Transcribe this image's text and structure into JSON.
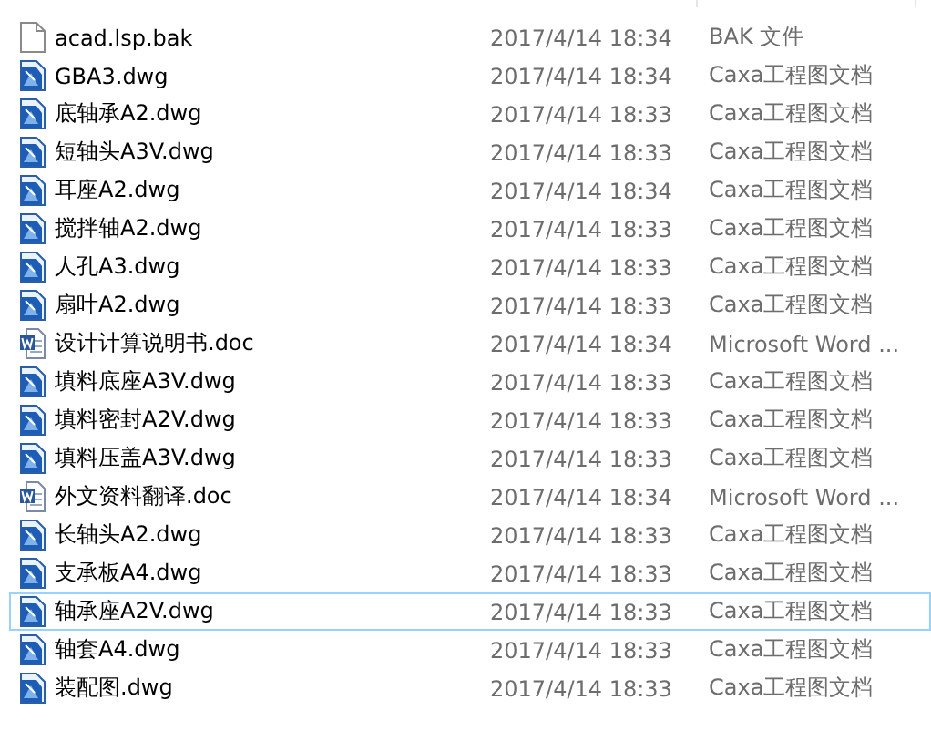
{
  "files": [
    {
      "kind": "bak",
      "name": "acad.lsp.bak",
      "modified": "2017/4/14 18:34",
      "type": "BAK 文件",
      "selected": false
    },
    {
      "kind": "dwg",
      "name": "GBA3.dwg",
      "modified": "2017/4/14 18:34",
      "type": "Caxa工程图文档",
      "selected": false
    },
    {
      "kind": "dwg",
      "name": "底轴承A2.dwg",
      "modified": "2017/4/14 18:33",
      "type": "Caxa工程图文档",
      "selected": false
    },
    {
      "kind": "dwg",
      "name": "短轴头A3V.dwg",
      "modified": "2017/4/14 18:33",
      "type": "Caxa工程图文档",
      "selected": false
    },
    {
      "kind": "dwg",
      "name": "耳座A2.dwg",
      "modified": "2017/4/14 18:34",
      "type": "Caxa工程图文档",
      "selected": false
    },
    {
      "kind": "dwg",
      "name": "搅拌轴A2.dwg",
      "modified": "2017/4/14 18:33",
      "type": "Caxa工程图文档",
      "selected": false
    },
    {
      "kind": "dwg",
      "name": "人孔A3.dwg",
      "modified": "2017/4/14 18:33",
      "type": "Caxa工程图文档",
      "selected": false
    },
    {
      "kind": "dwg",
      "name": "扇叶A2.dwg",
      "modified": "2017/4/14 18:33",
      "type": "Caxa工程图文档",
      "selected": false
    },
    {
      "kind": "doc",
      "name": "设计计算说明书.doc",
      "modified": "2017/4/14 18:34",
      "type": "Microsoft Word ...",
      "selected": false
    },
    {
      "kind": "dwg",
      "name": "填料底座A3V.dwg",
      "modified": "2017/4/14 18:33",
      "type": "Caxa工程图文档",
      "selected": false
    },
    {
      "kind": "dwg",
      "name": "填料密封A2V.dwg",
      "modified": "2017/4/14 18:33",
      "type": "Caxa工程图文档",
      "selected": false
    },
    {
      "kind": "dwg",
      "name": "填料压盖A3V.dwg",
      "modified": "2017/4/14 18:33",
      "type": "Caxa工程图文档",
      "selected": false
    },
    {
      "kind": "doc",
      "name": "外文资料翻译.doc",
      "modified": "2017/4/14 18:34",
      "type": "Microsoft Word ...",
      "selected": false
    },
    {
      "kind": "dwg",
      "name": "长轴头A2.dwg",
      "modified": "2017/4/14 18:33",
      "type": "Caxa工程图文档",
      "selected": false
    },
    {
      "kind": "dwg",
      "name": "支承板A4.dwg",
      "modified": "2017/4/14 18:33",
      "type": "Caxa工程图文档",
      "selected": false
    },
    {
      "kind": "dwg",
      "name": "轴承座A2V.dwg",
      "modified": "2017/4/14 18:33",
      "type": "Caxa工程图文档",
      "selected": true
    },
    {
      "kind": "dwg",
      "name": "轴套A4.dwg",
      "modified": "2017/4/14 18:33",
      "type": "Caxa工程图文档",
      "selected": false
    },
    {
      "kind": "dwg",
      "name": "装配图.dwg",
      "modified": "2017/4/14 18:33",
      "type": "Caxa工程图文档",
      "selected": false
    }
  ]
}
